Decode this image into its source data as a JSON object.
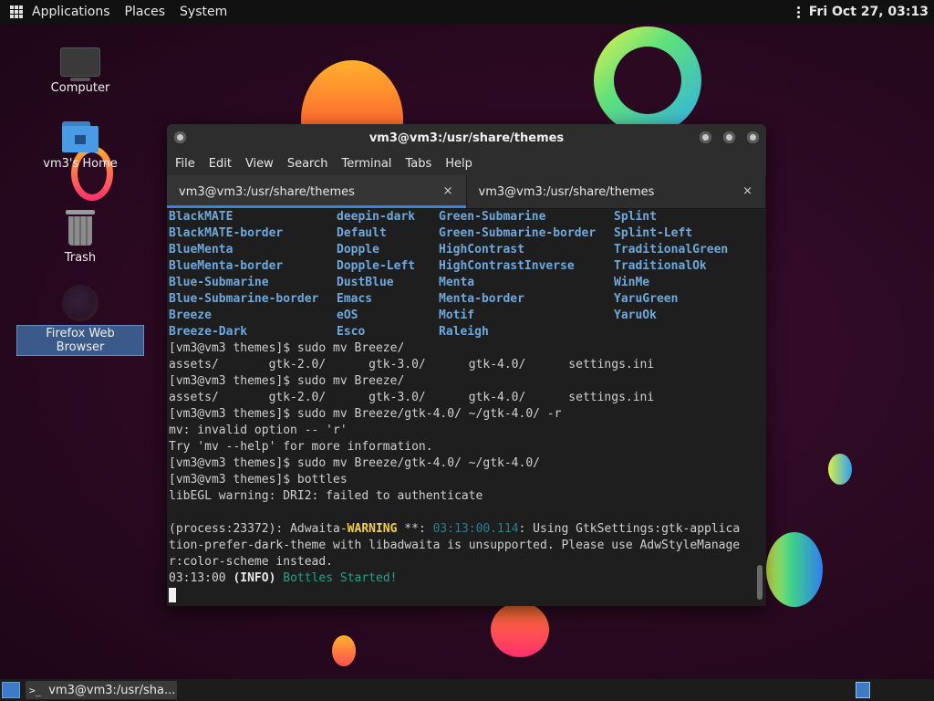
{
  "topbar": {
    "applications": "Applications",
    "places": "Places",
    "system": "System",
    "clock": "Fri Oct 27, 03:13"
  },
  "desktop": {
    "computer": "Computer",
    "home": "vm3's Home",
    "trash": "Trash",
    "firefox": "Firefox Web Browser"
  },
  "window": {
    "title": "vm3@vm3:/usr/share/themes",
    "menu": [
      "File",
      "Edit",
      "View",
      "Search",
      "Terminal",
      "Tabs",
      "Help"
    ],
    "tabs": [
      {
        "label": "vm3@vm3:/usr/share/themes",
        "close": "×"
      },
      {
        "label": "vm3@vm3:/usr/share/themes",
        "close": "×"
      }
    ]
  },
  "terminal": {
    "theme_rows": [
      [
        "BlackMATE",
        "deepin-dark",
        "Green-Submarine",
        "Splint"
      ],
      [
        "BlackMATE-border",
        "Default",
        "Green-Submarine-border",
        "Splint-Left"
      ],
      [
        "BlueMenta",
        "Dopple",
        "HighContrast",
        "TraditionalGreen"
      ],
      [
        "BlueMenta-border",
        "Dopple-Left",
        "HighContrastInverse",
        "TraditionalOk"
      ],
      [
        "Blue-Submarine",
        "DustBlue",
        "Menta",
        "WinMe"
      ],
      [
        "Blue-Submarine-border",
        "Emacs",
        "Menta-border",
        "YaruGreen"
      ],
      [
        "Breeze",
        "eOS",
        "Motif",
        "YaruOk"
      ],
      [
        "Breeze-Dark",
        "Esco",
        "Raleigh",
        ""
      ]
    ],
    "lines": [
      "[vm3@vm3 themes]$ sudo mv Breeze/",
      "assets/       gtk-2.0/      gtk-3.0/      gtk-4.0/      settings.ini",
      "[vm3@vm3 themes]$ sudo mv Breeze/",
      "assets/       gtk-2.0/      gtk-3.0/      gtk-4.0/      settings.ini",
      "[vm3@vm3 themes]$ sudo mv Breeze/gtk-4.0/ ~/gtk-4.0/ -r",
      "mv: invalid option -- 'r'",
      "Try 'mv --help' for more information.",
      "[vm3@vm3 themes]$ sudo mv Breeze/gtk-4.0/ ~/gtk-4.0/",
      "[vm3@vm3 themes]$ bottles",
      "libEGL warning: DRI2: failed to authenticate",
      ""
    ],
    "warn_prefix": "(process:23372): Adwaita-",
    "warn_word": "WARNING",
    "warn_mid": " **: ",
    "warn_time": "03:13:00.114",
    "warn_rest": ": Using GtkSettings:gtk-applica",
    "warn_line2": "tion-prefer-dark-theme with libadwaita is unsupported. Please use AdwStyleManage",
    "warn_line3": "r:color-scheme instead.",
    "info_time": "03:13:00 ",
    "info_tag": "(INFO)",
    "info_msg": " Bottles Started!"
  },
  "taskbar": {
    "task_label": "vm3@vm3:/usr/sha...",
    "term_glyph": ">_"
  },
  "colors": {
    "accent": "#3584e4",
    "theme_name": "#6fa8dc",
    "warning": "#f4d03f",
    "started": "#27a187"
  }
}
